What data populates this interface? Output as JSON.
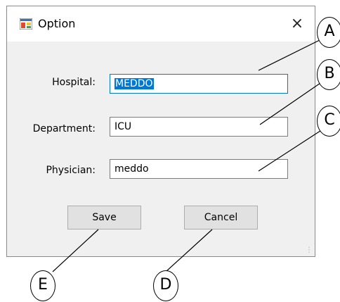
{
  "window": {
    "title": "Option",
    "close_glyph": "×",
    "icon": "window-app-icon",
    "accent": "#0078d7"
  },
  "form": {
    "hospital_label": "Hospital:",
    "hospital_value": "MEDDO",
    "department_label": "Department:",
    "department_value": "ICU",
    "physician_label": "Physician:",
    "physician_value": "meddo"
  },
  "buttons": {
    "save_label": "Save",
    "cancel_label": "Cancel"
  },
  "callouts": {
    "a": "A",
    "b": "B",
    "c": "C",
    "d": "D",
    "e": "E"
  }
}
